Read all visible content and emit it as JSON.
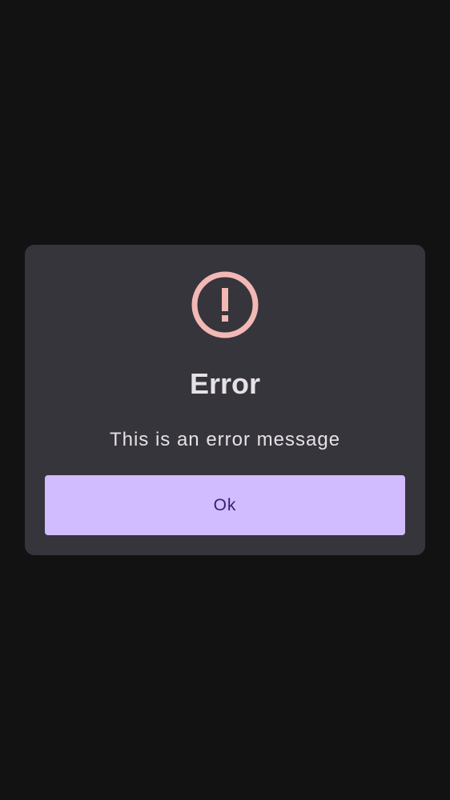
{
  "background_color": "#121212",
  "dialog": {
    "icon": "error-exclamation-icon",
    "icon_color": "#f2b8b5",
    "title": "Error",
    "message": "This is an error message",
    "ok_label": "Ok",
    "surface_color": "#36353b",
    "button_color": "#d0bcff",
    "button_text_color": "#381e72"
  }
}
